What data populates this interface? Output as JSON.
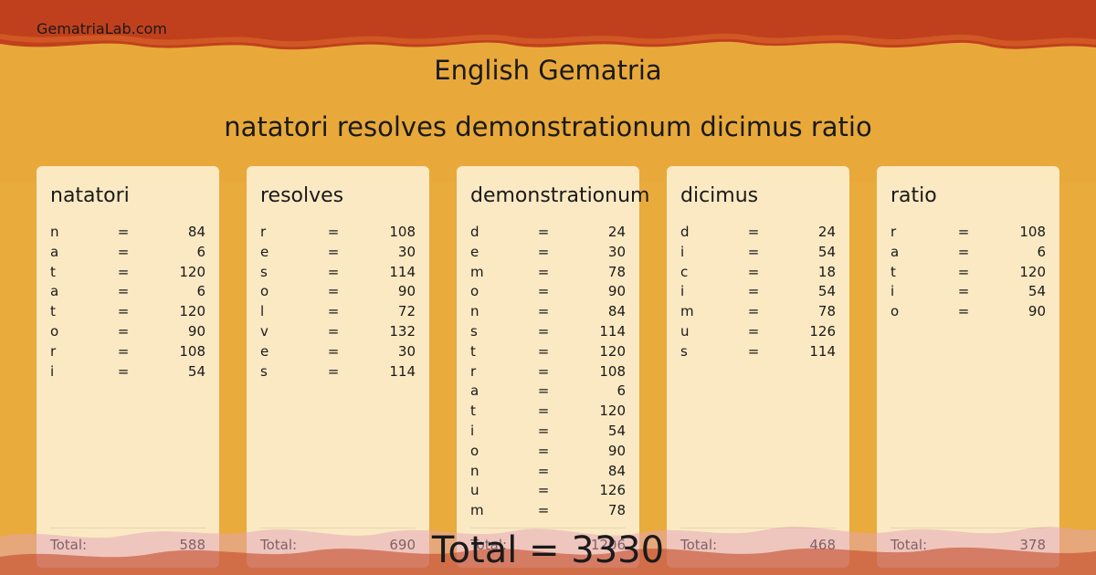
{
  "site": "GematriaLab.com",
  "title": "English Gematria",
  "phrase": "natatori resolves demonstrationum dicimus ratio",
  "total_label": "Total:",
  "grand_total": "Total = 3330",
  "colors": {
    "top_band": "#c0401d",
    "background": "#e8a93a",
    "card": "#fff6e0",
    "bottom_band": "#e3a3b8"
  },
  "cards": [
    {
      "word": "natatori",
      "total": "588",
      "rows": [
        [
          "n",
          "84"
        ],
        [
          "a",
          "6"
        ],
        [
          "t",
          "120"
        ],
        [
          "a",
          "6"
        ],
        [
          "t",
          "120"
        ],
        [
          "o",
          "90"
        ],
        [
          "r",
          "108"
        ],
        [
          "i",
          "54"
        ]
      ]
    },
    {
      "word": "resolves",
      "total": "690",
      "rows": [
        [
          "r",
          "108"
        ],
        [
          "e",
          "30"
        ],
        [
          "s",
          "114"
        ],
        [
          "o",
          "90"
        ],
        [
          "l",
          "72"
        ],
        [
          "v",
          "132"
        ],
        [
          "e",
          "30"
        ],
        [
          "s",
          "114"
        ]
      ]
    },
    {
      "word": "demonstrationum",
      "total": "1206",
      "rows": [
        [
          "d",
          "24"
        ],
        [
          "e",
          "30"
        ],
        [
          "m",
          "78"
        ],
        [
          "o",
          "90"
        ],
        [
          "n",
          "84"
        ],
        [
          "s",
          "114"
        ],
        [
          "t",
          "120"
        ],
        [
          "r",
          "108"
        ],
        [
          "a",
          "6"
        ],
        [
          "t",
          "120"
        ],
        [
          "i",
          "54"
        ],
        [
          "o",
          "90"
        ],
        [
          "n",
          "84"
        ],
        [
          "u",
          "126"
        ],
        [
          "m",
          "78"
        ]
      ]
    },
    {
      "word": "dicimus",
      "total": "468",
      "rows": [
        [
          "d",
          "24"
        ],
        [
          "i",
          "54"
        ],
        [
          "c",
          "18"
        ],
        [
          "i",
          "54"
        ],
        [
          "m",
          "78"
        ],
        [
          "u",
          "126"
        ],
        [
          "s",
          "114"
        ]
      ]
    },
    {
      "word": "ratio",
      "total": "378",
      "rows": [
        [
          "r",
          "108"
        ],
        [
          "a",
          "6"
        ],
        [
          "t",
          "120"
        ],
        [
          "i",
          "54"
        ],
        [
          "o",
          "90"
        ]
      ]
    }
  ]
}
